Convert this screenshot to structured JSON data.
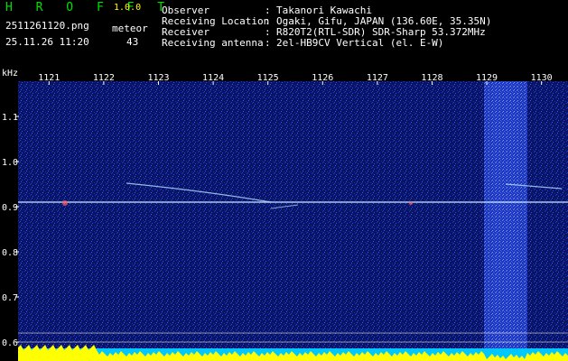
{
  "app": {
    "title": "H R O F F T",
    "version": "1.0.0"
  },
  "file": {
    "name": "2511261120.png",
    "timestamp": "25.11.26 11:20"
  },
  "counter": {
    "label": "meteor",
    "value": "43"
  },
  "info": [
    {
      "key": "Observer",
      "sep": ":",
      "value": "Takanori Kawachi"
    },
    {
      "key": "Receiving Location",
      "sep": ":",
      "value": "Ogaki, Gifu, JAPAN (136.60E, 35.35N)"
    },
    {
      "key": "Receiver",
      "sep": ":",
      "value": "R820T2(RTL-SDR) SDR-Sharp 53.372MHz"
    },
    {
      "key": "Receiving antenna",
      "sep": ":",
      "value": "2el-HB9CV Vertical (el. E-W)"
    }
  ],
  "spectrogram": {
    "y_unit": "kHz",
    "x_ticks": [
      "1121",
      "1122",
      "1123",
      "1124",
      "1125",
      "1126",
      "1127",
      "1128",
      "1129",
      "1130"
    ],
    "y_ticks": [
      "1.1",
      "1.0",
      "0.9",
      "0.8",
      "0.7",
      "0.6"
    ],
    "x_range": [
      1120.5,
      1130.5
    ],
    "y_range": [
      0.58,
      1.2
    ],
    "carrier_freq": 0.91,
    "colors": {
      "background": "#0a1464",
      "noise": "#2a4aff",
      "trace": "#c8e8ff",
      "axis_text": "#ffff00",
      "tick_text": "#ffffff",
      "level_fill": "#ffff00",
      "level_base": "#00c8ff"
    }
  }
}
